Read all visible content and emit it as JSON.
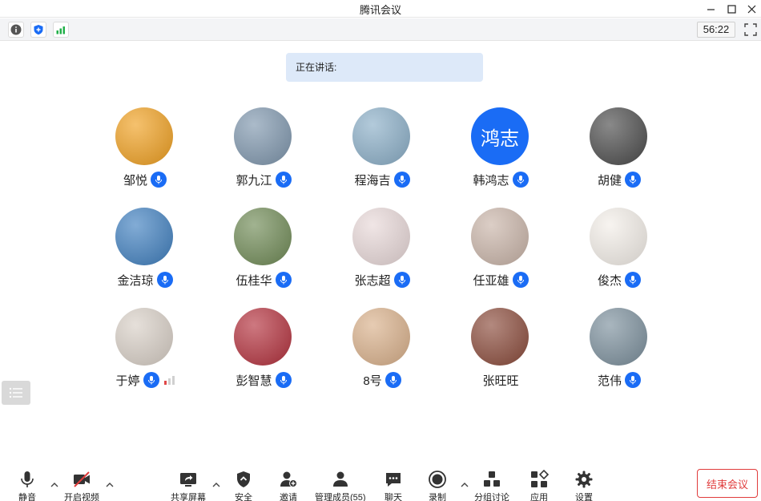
{
  "window": {
    "title": "腾讯会议"
  },
  "infobar": {
    "timer": "56:22"
  },
  "speaking": {
    "label": "正在讲话:"
  },
  "participants": [
    {
      "name": "邹悦",
      "avatar_text": "",
      "avatar_color": "#f0a020",
      "mic": true
    },
    {
      "name": "郭九江",
      "avatar_text": "",
      "avatar_color": "#7e96ad",
      "mic": true
    },
    {
      "name": "程海吉",
      "avatar_text": "",
      "avatar_color": "#8aaec7",
      "mic": true
    },
    {
      "name": "韩鸿志",
      "avatar_text": "鸿志",
      "avatar_color": "#1a6cf5",
      "mic": true
    },
    {
      "name": "胡健",
      "avatar_text": "",
      "avatar_color": "#4a4a4a",
      "mic": true
    },
    {
      "name": "金洁琼",
      "avatar_text": "",
      "avatar_color": "#3f7fbf",
      "mic": true
    },
    {
      "name": "伍桂华",
      "avatar_text": "",
      "avatar_color": "#6f8a55",
      "mic": true
    },
    {
      "name": "张志超",
      "avatar_text": "",
      "avatar_color": "#e8d8d8",
      "mic": true
    },
    {
      "name": "任亚雄",
      "avatar_text": "",
      "avatar_color": "#c9b4a8",
      "mic": true
    },
    {
      "name": "俊杰",
      "avatar_text": "",
      "avatar_color": "#f3eee8",
      "mic": true
    },
    {
      "name": "于婷",
      "avatar_text": "",
      "avatar_color": "#d8cfc6",
      "mic": true,
      "signal": true
    },
    {
      "name": "彭智慧",
      "avatar_text": "",
      "avatar_color": "#b3303c",
      "mic": true
    },
    {
      "name": "8号",
      "avatar_text": "",
      "avatar_color": "#d9b08a",
      "mic": true
    },
    {
      "name": "张旺旺",
      "avatar_text": "",
      "avatar_color": "#8a4a3a",
      "mic": false
    },
    {
      "name": "范伟",
      "avatar_text": "",
      "avatar_color": "#7b8f9c",
      "mic": true
    }
  ],
  "toolbar": {
    "mute": "静音",
    "video": "开启视频",
    "share": "共享屏幕",
    "security": "安全",
    "invite": "邀请",
    "members": "管理成员(55)",
    "chat": "聊天",
    "record": "录制",
    "breakout": "分组讨论",
    "apps": "应用",
    "settings": "设置",
    "end": "结束会议"
  },
  "colors": {
    "accent": "#1a6cf5",
    "end": "#e03c3c",
    "banner": "#dde9f9"
  }
}
